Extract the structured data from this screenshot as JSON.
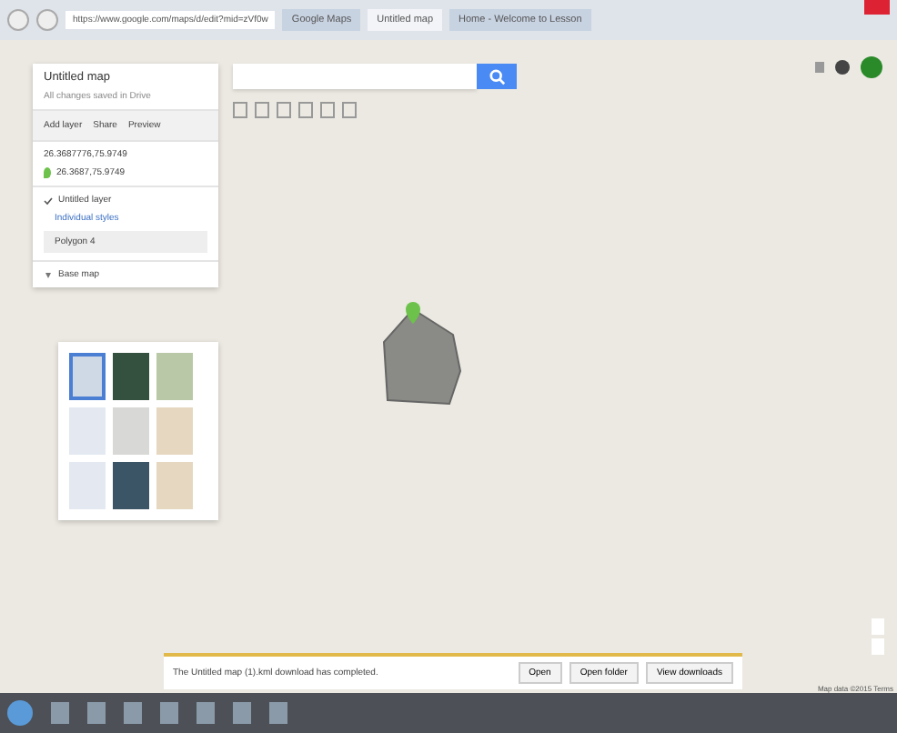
{
  "browser": {
    "url": "https://www.google.com/maps/d/edit?mid=zVf0w",
    "tabs": [
      {
        "label": "Google Maps",
        "selected": false
      },
      {
        "label": "Untitled map",
        "selected": true
      },
      {
        "label": "Home - Welcome to Lesson",
        "selected": false
      }
    ]
  },
  "map_panel": {
    "title": "Untitled map",
    "subtitle": "All changes saved in Drive",
    "actions": [
      "Add layer",
      "Share",
      "Preview"
    ],
    "search_result": {
      "query": "26.3687776,75.9749",
      "place": "26.3687,75.9749"
    },
    "layer": {
      "name": "Untitled layer",
      "style": "Individual styles",
      "item": "Polygon 4",
      "checked": true
    },
    "base_map": {
      "label": "Base map",
      "expanded": true,
      "thumbnails": [
        {
          "kind": "road",
          "selected": true
        },
        {
          "kind": "satellite",
          "selected": false
        },
        {
          "kind": "terrain",
          "selected": false
        },
        {
          "kind": "light",
          "selected": false
        },
        {
          "kind": "mono",
          "selected": false
        },
        {
          "kind": "atlas",
          "selected": false
        },
        {
          "kind": "light",
          "selected": false
        },
        {
          "kind": "dark",
          "selected": false
        },
        {
          "kind": "atlas",
          "selected": false
        }
      ]
    }
  },
  "download_bar": {
    "message": "The Untitled map (1).kml download has completed.",
    "buttons": [
      "Open",
      "Open folder",
      "View downloads"
    ]
  },
  "map_footer": "Map data ©2015   Terms"
}
